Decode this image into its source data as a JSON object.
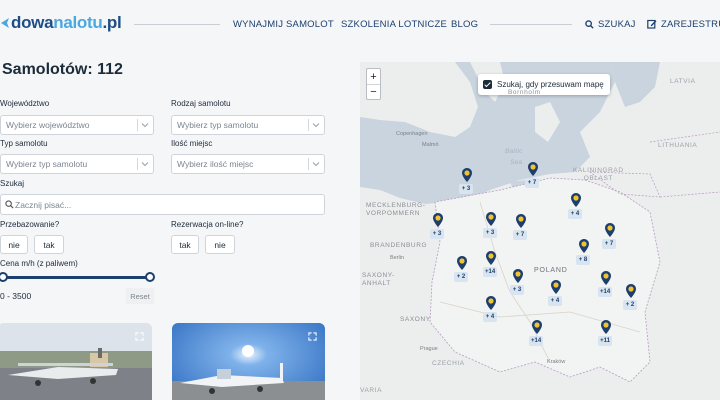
{
  "header": {
    "logo_main": "dowa",
    "logo_accent": "nalotu",
    "logo_tld": ".pl",
    "nav": [
      "WYNAJMIJ SAMOLOT",
      "SZKOLENIA LOTNICZE",
      "BLOG"
    ],
    "search_label": "SZUKAJ",
    "register_label": "ZAREJESTRUJ"
  },
  "main": {
    "title": "Samolotów: 112"
  },
  "filters": {
    "voivodeship": {
      "label": "Województwo",
      "placeholder": "Wybierz województwo"
    },
    "category": {
      "label": "Rodzaj samolotu",
      "placeholder": "Wybierz typ samolotu"
    },
    "type": {
      "label": "Typ samolotu",
      "placeholder": "Wybierz typ samolotu"
    },
    "seats": {
      "label": "Ilość miejsc",
      "placeholder": "Wybierz ilość miejsc"
    },
    "search": {
      "label": "Szukaj",
      "placeholder": "Zacznij pisać..."
    },
    "ferry": {
      "label": "Przebazowanie?",
      "options": [
        "nie",
        "tak"
      ]
    },
    "online": {
      "label": "Rezerwacja on-line?",
      "options": [
        "tak",
        "nie"
      ]
    },
    "price": {
      "label": "Cena m/h (z paliwem)",
      "range": "0 - 3500",
      "min_value": 0,
      "max_value": 3500,
      "reset_label": "Reset"
    }
  },
  "map": {
    "zoom_in": "+",
    "zoom_out": "−",
    "search_on_move": "Szukaj, gdy przesuwam mapę",
    "labels": {
      "bornholm": "Bornholm",
      "latvia": "LATVIA",
      "copenhagen": "Copenhagen",
      "malmo": "Malmö",
      "lithuania": "LITHUANIA",
      "kaliningrad": "KALININGRAD\nOBLAST",
      "mecklenburg": "MECKLENBURG-\nVORPOMMERN",
      "brandenburg": "BRANDENBURG",
      "berlin": "Berlin",
      "saxony_anhalt": "SAXONY-\nANHALT",
      "saxony": "SAXONY",
      "poland": "POLAND",
      "czechia": "CZECHIA",
      "prague": "Prague",
      "krakow": "Kraków",
      "bavaria": "VARIA",
      "sea1": "Baltic",
      "sea2": "Sea"
    },
    "clusters": [
      "+ 3",
      "+ 7",
      "+ 4",
      "+ 3",
      "+ 3",
      "+ 7",
      "+ 7",
      "+ 8",
      "+ 2",
      "+14",
      "+ 3",
      "+ 4",
      "+14",
      "+ 2",
      "+ 4",
      "+14",
      "+11"
    ]
  },
  "colors": {
    "brand": "#1e4e88",
    "accent": "#4aa8e0",
    "marker": "#1c3f6e",
    "marker_dot": "#f2c230"
  }
}
